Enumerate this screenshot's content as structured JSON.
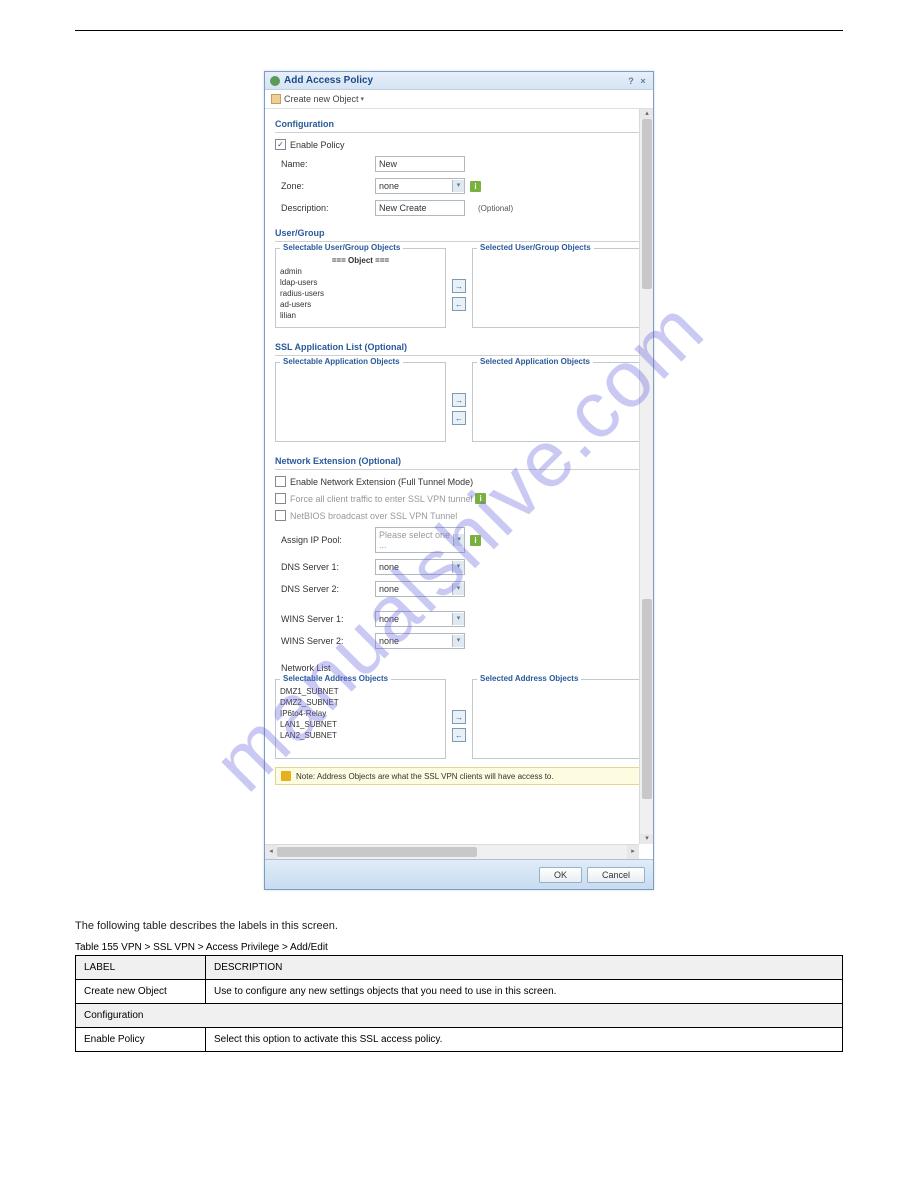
{
  "watermark": "manualshive.com",
  "dialog": {
    "title": "Add Access Policy",
    "help_btn": "?",
    "close_btn": "×",
    "create_new": "Create new Object",
    "create_arrow": "▾",
    "sections": {
      "configuration": "Configuration",
      "user_group": "User/Group",
      "ssl_app": "SSL Application List (Optional)",
      "net_ext": "Network Extension (Optional)"
    },
    "fields": {
      "enable_policy": "Enable Policy",
      "name_label": "Name:",
      "name_value": "New",
      "zone_label": "Zone:",
      "zone_value": "none",
      "desc_label": "Description:",
      "desc_value": "New Create",
      "optional": "(Optional)",
      "enable_ext": "Enable Network Extension (Full Tunnel Mode)",
      "force_traffic": "Force all client traffic to enter SSL VPN tunnel",
      "netbios": "NetBIOS broadcast over SSL VPN Tunnel",
      "assign_ip": "Assign IP Pool:",
      "assign_ip_value": "Please select one ...",
      "dns1": "DNS Server 1:",
      "dns2": "DNS Server 2:",
      "wins1": "WINS Server 1:",
      "wins2": "WINS Server 2:",
      "none_value": "none",
      "network_list": "Network List"
    },
    "lists": {
      "sel_user": "Selectable User/Group Objects",
      "selected_user": "Selected User/Group Objects",
      "sel_app": "Selectable Application Objects",
      "selected_app": "Selected Application Objects",
      "sel_addr": "Selectable Address Objects",
      "selected_addr": "Selected Address Objects",
      "obj_header": "=== Object ===",
      "users": [
        "admin",
        "ldap-users",
        "radius-users",
        "ad-users",
        "lilian"
      ],
      "addrs": [
        "DMZ1_SUBNET",
        "DMZ2_SUBNET",
        "IP6to4-Relay",
        "LAN1_SUBNET",
        "LAN2_SUBNET"
      ]
    },
    "note": "Note: Address Objects are what the SSL VPN clients will have access to.",
    "btn_ok": "OK",
    "btn_cancel": "Cancel",
    "move_right": "➜",
    "move_left": "⬅"
  },
  "desc": "The following table describes the labels in this screen.",
  "table": {
    "caption_prefix": "Table 155   ",
    "caption": "VPN > SSL VPN > Access Privilege > Add/Edit",
    "hdr_label": "LABEL",
    "hdr_desc": "DESCRIPTION",
    "row1_label": "Create new Object",
    "row1_desc": "Use to configure any new settings objects that you need to use in this screen.",
    "row2_section": "Configuration",
    "row3_label": "Enable Policy",
    "row3_desc": "Select this option to activate this SSL access policy."
  }
}
